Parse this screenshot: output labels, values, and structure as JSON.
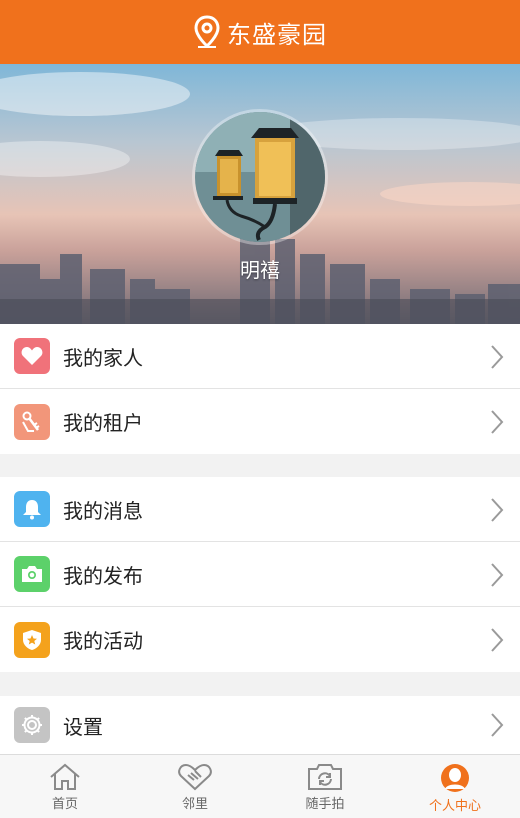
{
  "header": {
    "title": "东盛豪园",
    "icon": "location-pin-icon"
  },
  "profile": {
    "name": "明禧",
    "avatar": "street-lamp-photo"
  },
  "menu_groups": [
    [
      {
        "label": "我的家人",
        "icon": "heart-icon",
        "color": "#f0727a"
      },
      {
        "label": "我的租户",
        "icon": "key-tag-icon",
        "color": "#f2967a"
      }
    ],
    [
      {
        "label": "我的消息",
        "icon": "bell-icon",
        "color": "#4fb3ef"
      },
      {
        "label": "我的发布",
        "icon": "camera-icon",
        "color": "#5cd16a"
      },
      {
        "label": "我的活动",
        "icon": "star-badge-icon",
        "color": "#f4a21c"
      }
    ],
    [
      {
        "label": "设置",
        "icon": "gear-icon",
        "color": "#c4c4c4"
      }
    ]
  ],
  "tabs": [
    {
      "label": "首页",
      "icon": "home-icon",
      "active": false
    },
    {
      "label": "邻里",
      "icon": "handshake-icon",
      "active": false
    },
    {
      "label": "随手拍",
      "icon": "camera-refresh-icon",
      "active": false
    },
    {
      "label": "个人中心",
      "icon": "person-icon",
      "active": true
    }
  ],
  "colors": {
    "accent": "#f0711c",
    "tab_inactive": "#666666"
  }
}
